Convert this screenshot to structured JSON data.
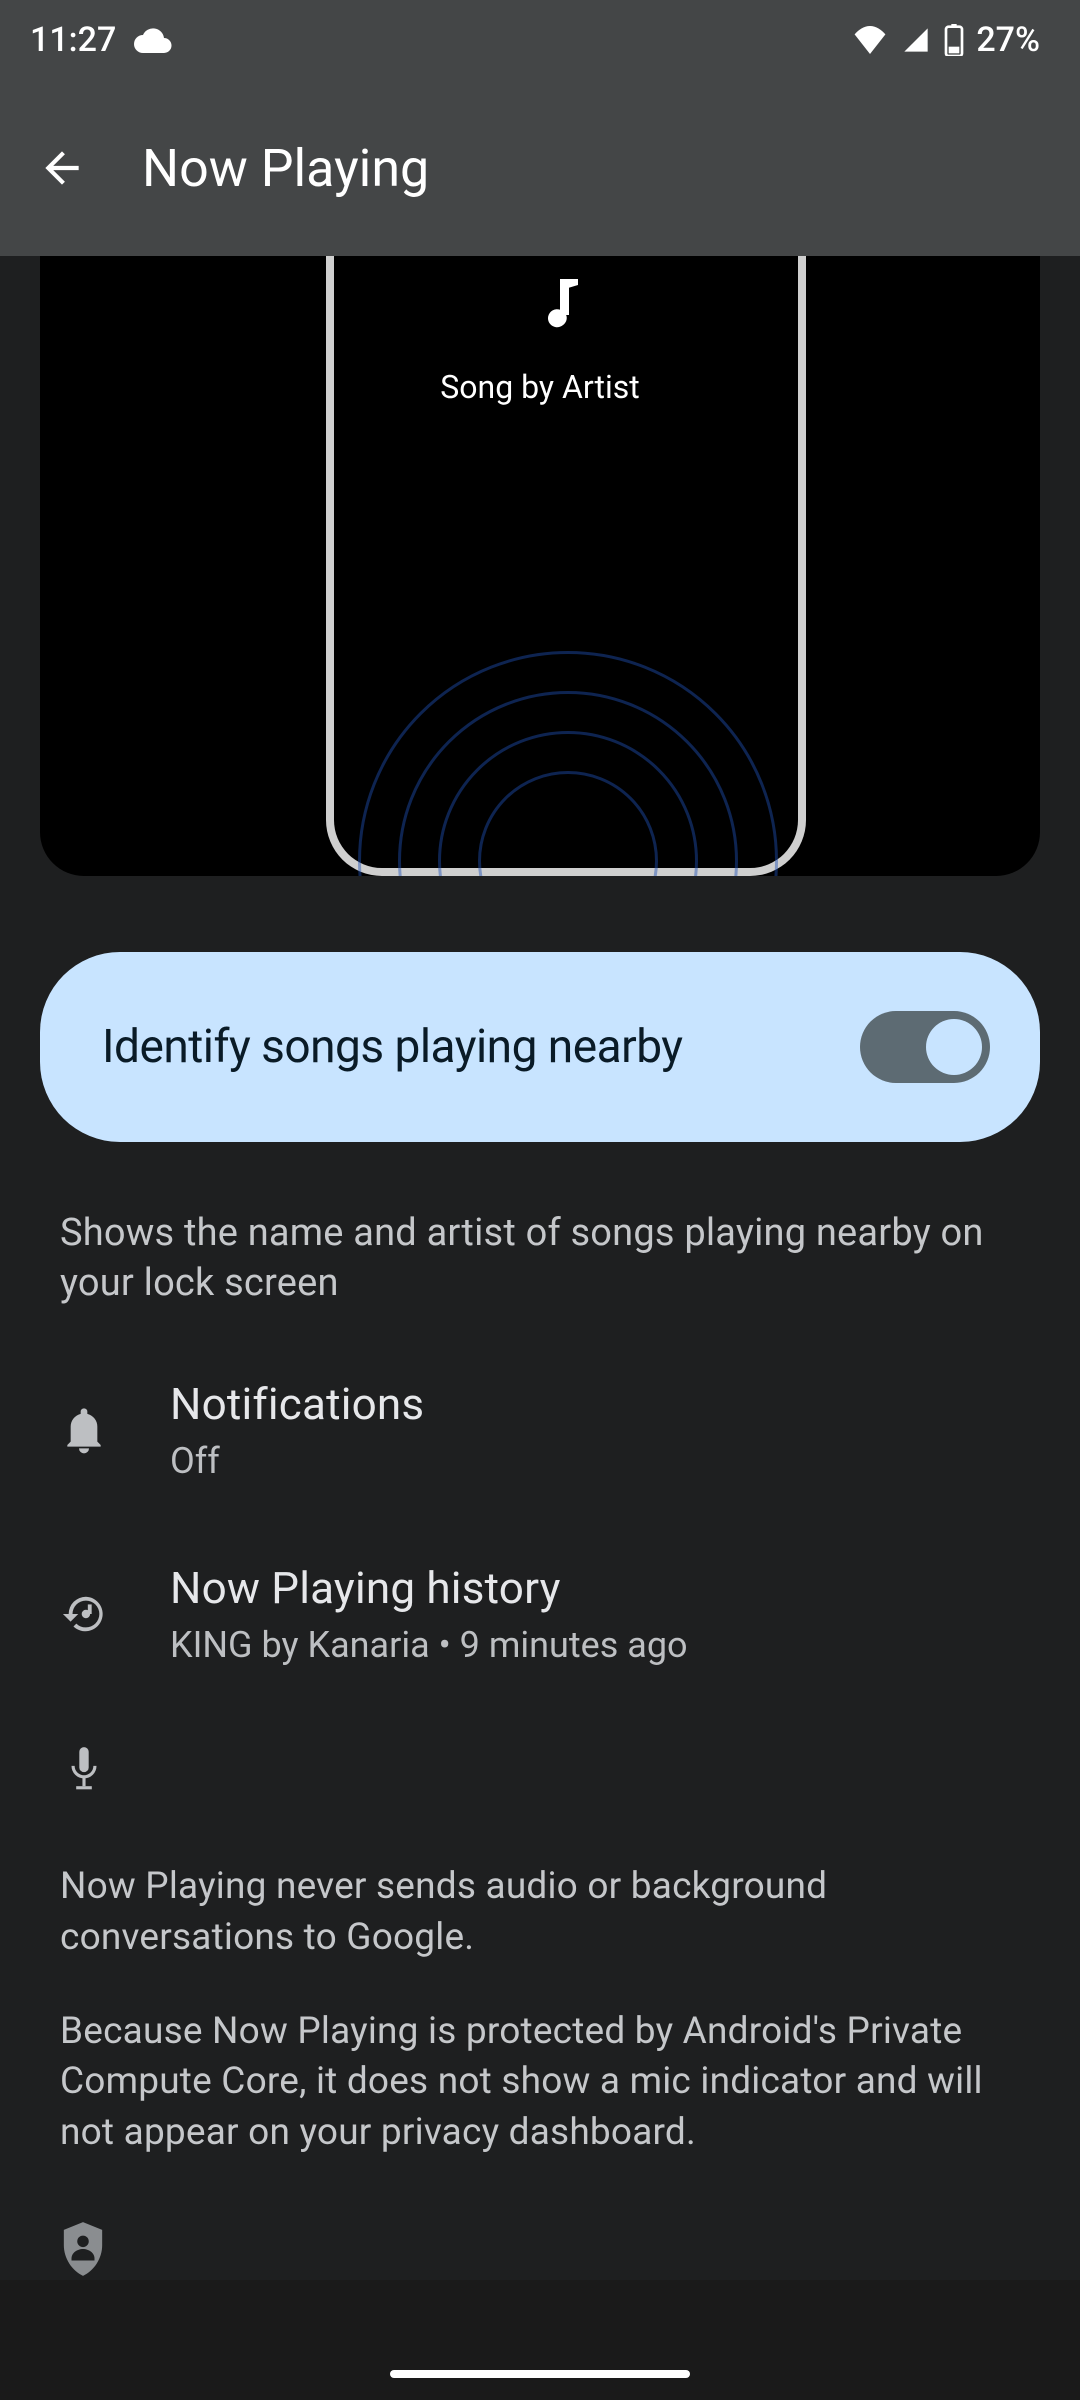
{
  "status": {
    "time": "11:27",
    "battery_text": "27%"
  },
  "header": {
    "title": "Now Playing"
  },
  "hero": {
    "song_placeholder": "Song by Artist"
  },
  "identify": {
    "label": "Identify songs playing nearby",
    "enabled": true
  },
  "description": "Shows the name and artist of songs playing nearby on your lock screen",
  "rows": {
    "notifications": {
      "title": "Notifications",
      "sub": "Off"
    },
    "history": {
      "title": "Now Playing history",
      "sub": "KING by Kanaria • 9 minutes ago"
    }
  },
  "privacy": {
    "p1": "Now Playing never sends audio or background conversations to Google.",
    "p2": "Because Now Playing is protected by Android's Private Compute Core, it does not show a mic indicator and will not appear on your privacy dashboard."
  }
}
